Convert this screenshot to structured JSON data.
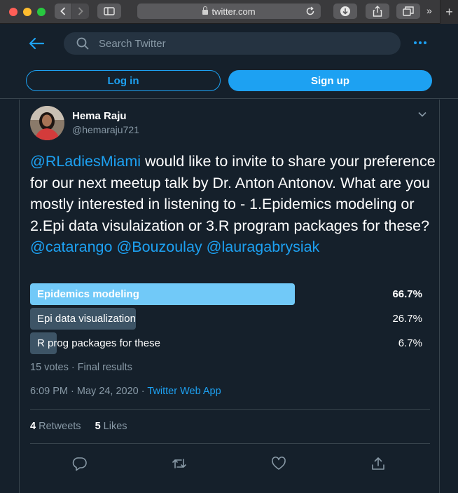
{
  "browser": {
    "url": "twitter.com",
    "icons": [
      "back-icon",
      "forward-icon",
      "sidebar-icon",
      "lock-icon",
      "reload-icon",
      "download-icon",
      "share-icon",
      "tabs-icon",
      "more-icon",
      "new-tab-icon"
    ]
  },
  "header": {
    "search_placeholder": "Search Twitter",
    "login_label": "Log in",
    "signup_label": "Sign up",
    "accent": "#1da1f2"
  },
  "tweet": {
    "author_name": "Hema Raju",
    "author_handle": "@hemaraju721",
    "text_mention": "@RLadiesMiami",
    "text_body": " would like to invite to share your preference for our next meetup talk by Dr. Anton Antonov. What are you mostly interested in listening to - 1.Epidemics modeling or 2.Epi data visulaization or 3.R program packages for these?",
    "mentions": [
      "@catarango",
      "@Bouzoulay",
      "@lauragabrysiak"
    ],
    "poll": {
      "options": [
        {
          "label": "Epidemics modeling",
          "percent_text": "66.7%",
          "fraction": 0.667,
          "leading": true
        },
        {
          "label": "Epi data visualization",
          "percent_text": "26.7%",
          "fraction": 0.267,
          "leading": false
        },
        {
          "label": "R prog packages for these",
          "percent_text": "6.7%",
          "fraction": 0.067,
          "leading": false
        }
      ],
      "summary": "15 votes · Final results"
    },
    "timestamp": "6:09 PM · May 24, 2020 · ",
    "source": "Twitter Web App",
    "retweets_count": "4",
    "retweets_label": "Retweets",
    "likes_count": "5",
    "likes_label": "Likes"
  }
}
